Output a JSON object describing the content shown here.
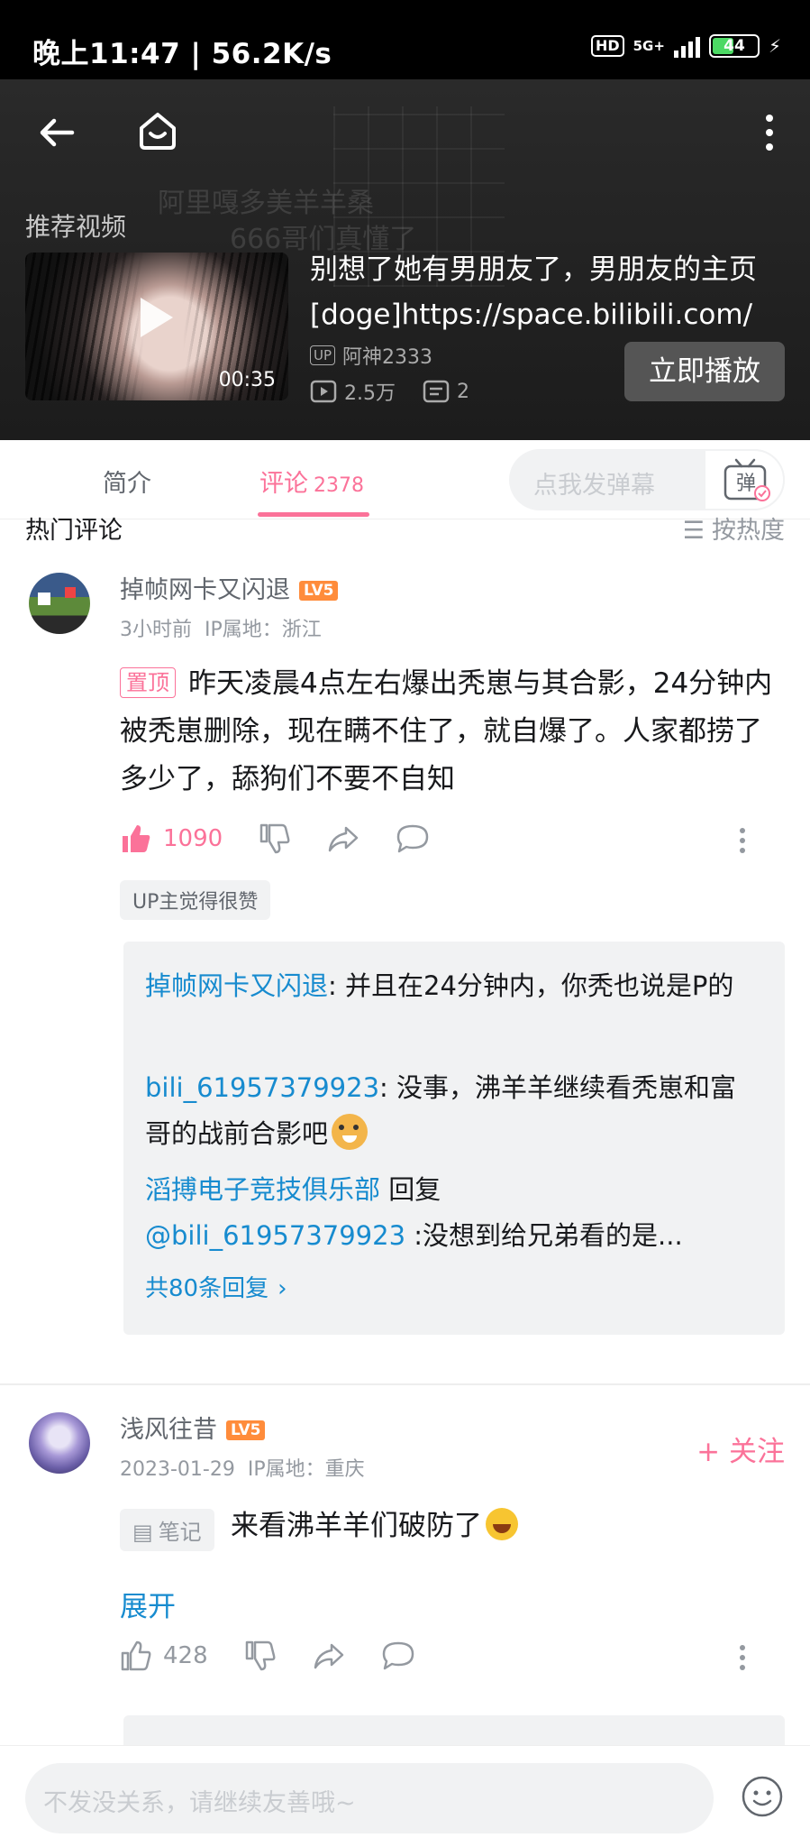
{
  "status_bar": {
    "time": "晚上11:47 | 56.2K/s",
    "hd": "HD",
    "network": "5G+",
    "battery": "44"
  },
  "header": {
    "background_text_1": "阿里嘎多美羊羊桑",
    "background_text_2": "666哥们真懂了"
  },
  "recommend": {
    "label": "推荐视频",
    "duration": "00:35",
    "title": "别想了她有男朋友了，男朋友的主页[doge]https://space.bilibili.com/",
    "up_badge": "UP",
    "up_name": "阿神2333",
    "views": "2.5万",
    "danmaku_count": "2",
    "play_button": "立即播放"
  },
  "tabs": {
    "intro": "简介",
    "comments": "评论",
    "comments_count": "2378",
    "danmaku_placeholder": "点我发弹幕",
    "danmaku_button": "弹"
  },
  "comments_header": {
    "title": "热门评论",
    "sort": "按热度"
  },
  "comment1": {
    "username": "掉帧网卡又闪退",
    "level": "LV5",
    "time": "3小时前",
    "ip": "IP属地：浙江",
    "pinned": "置顶",
    "text": "昨天凌晨4点左右爆出秃崽与其合影，24分钟内被秃崽删除，现在瞒不住了，就自爆了。人家都捞了多少了，舔狗们不要不自知",
    "likes": "1090",
    "up_tag": "UP主觉得很赞",
    "replies": [
      {
        "user": "掉帧网卡又闪退",
        "sep": ":",
        "text": " 并且在24分钟内，你秃也说是P的"
      },
      {
        "user": "bili_61957379923",
        "sep": ":",
        "text": " 没事，沸羊羊继续看秃崽和富哥的战前合影吧"
      },
      {
        "user": "滔搏电子竞技俱乐部",
        "mid": " 回复 ",
        "mention": "@bili_61957379923",
        "text": " :没想到给兄弟看的是..."
      }
    ],
    "more_replies": "共80条回复"
  },
  "comment2": {
    "username": "浅风往昔",
    "level": "LV5",
    "time": "2023-01-29",
    "ip": "IP属地：重庆",
    "follow": "+ 关注",
    "note_tag": "笔记",
    "text": "来看沸羊羊们破防了",
    "expand": "展开",
    "likes": "428"
  },
  "bottom": {
    "input_placeholder": "不发没关系，请继续友善哦~"
  },
  "colors": {
    "pink": "#fb7299",
    "blue": "#178bcf",
    "gray": "#9499a0"
  }
}
